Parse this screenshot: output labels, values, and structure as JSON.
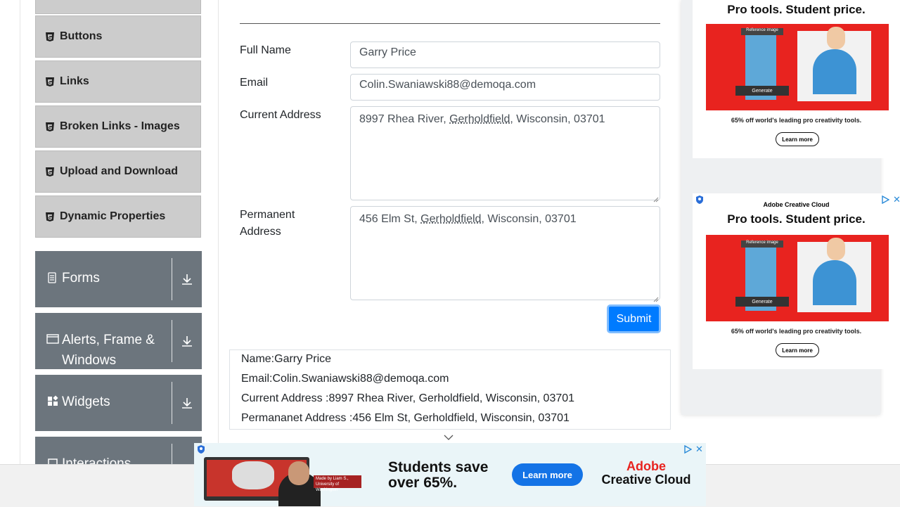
{
  "sidebar": {
    "elements_items": [
      {
        "label": "Buttons"
      },
      {
        "label": "Links"
      },
      {
        "label": "Broken Links - Images"
      },
      {
        "label": "Upload and Download"
      },
      {
        "label": "Dynamic Properties"
      }
    ],
    "groups": [
      {
        "label": "Forms",
        "icon": "form-icon"
      },
      {
        "label": "Alerts, Frame & Windows",
        "icon": "window-icon"
      },
      {
        "label": "Widgets",
        "icon": "widgets-icon"
      },
      {
        "label": "Interactions",
        "icon": "interactions-icon"
      }
    ]
  },
  "form": {
    "full_name_label": "Full Name",
    "full_name_value": "Garry Price",
    "email_label": "Email",
    "email_value": "Colin.Swaniawski88@demoqa.com",
    "current_address_label": "Current Address",
    "current_address_parts": [
      "8997 Rhea River, ",
      "Gerholdfield",
      ", Wisconsin, 03701"
    ],
    "permanent_address_label": "Permanent Address",
    "permanent_address_parts": [
      "456 Elm St, ",
      "Gerholdfield",
      ", Wisconsin, 03701"
    ],
    "submit_label": "Submit"
  },
  "output": {
    "name": "Name:Garry Price",
    "email": "Email:Colin.Swaniawski88@demoqa.com",
    "current_address": "Current Address :8997 Rhea River, Gerholdfield, Wisconsin, 03701",
    "permanent_address": "Permananet Address :456 Elm St, Gerholdfield, Wisconsin, 03701"
  },
  "ads": {
    "brand": "Adobe Creative Cloud",
    "headline": "Pro tools. Student price.",
    "reference_label": "Reference image",
    "generate_label": "Generate",
    "footnote": "65% off world's leading pro creativity tools.",
    "cta": "Learn more",
    "bottom_headline": "Students save over 65%.",
    "bottom_cta": "Learn more",
    "bottom_brand_top": "Adobe",
    "bottom_brand_bottom": "Creative Cloud",
    "bottom_caption": "Made by Liam S., University of Washington"
  },
  "colors": {
    "primary": "#007bff",
    "sidebar_group": "#6c757d",
    "sidebar_item": "#cccccc",
    "adobe_red": "#e8231f"
  }
}
